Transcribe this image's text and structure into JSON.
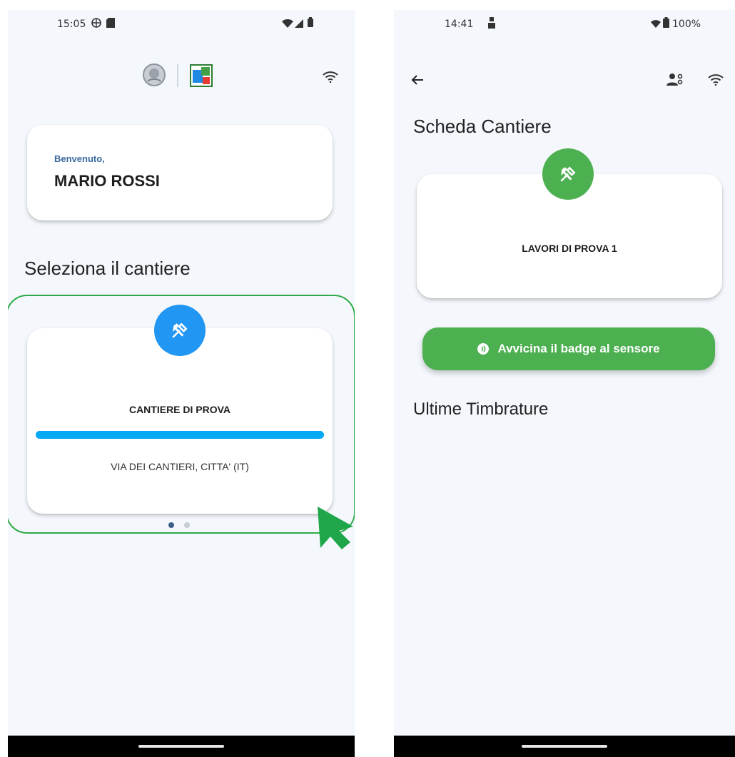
{
  "left_screen": {
    "status": {
      "time": "15:05"
    },
    "welcome": {
      "greeting": "Benvenuto,",
      "name": "MARIO ROSSI"
    },
    "section_title": "Seleziona il cantiere",
    "site_card": {
      "name": "CANTIERE DI PROVA",
      "address": "VIA DEI CANTIERI, CITTA' (IT)",
      "progress_fraction": 1.0
    },
    "pager": {
      "total": 2,
      "active": 0
    },
    "colors": {
      "accent_blue": "#2196f3",
      "progress": "#03a9f4",
      "highlight": "#2eaa48"
    }
  },
  "right_screen": {
    "status": {
      "time": "14:41",
      "battery": "100%"
    },
    "page_title": "Scheda Cantiere",
    "site_card": {
      "name": "LAVORI DI PROVA 1"
    },
    "badge_button_label": "Avvicina il badge al sensore",
    "section_title": "Ultime Timbrature",
    "colors": {
      "accent_green": "#4caf50"
    }
  }
}
